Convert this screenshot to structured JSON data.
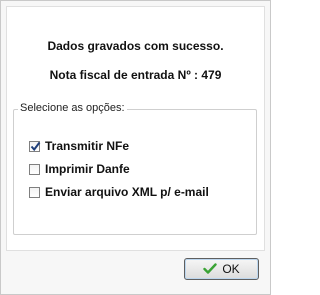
{
  "dialog": {
    "message_saved": "Dados gravados com sucesso.",
    "message_invoice": "Nota fiscal de entrada Nº : 479"
  },
  "options": {
    "legend": "Selecione as opções:",
    "items": [
      {
        "label": "Transmitir NFe",
        "checked": true
      },
      {
        "label": "Imprimir Danfe",
        "checked": false
      },
      {
        "label": "Enviar arquivo XML p/ e-mail",
        "checked": false
      }
    ]
  },
  "footer": {
    "ok_label": "OK",
    "ok_icon": "check-icon",
    "ok_icon_color": "#3aa335"
  }
}
